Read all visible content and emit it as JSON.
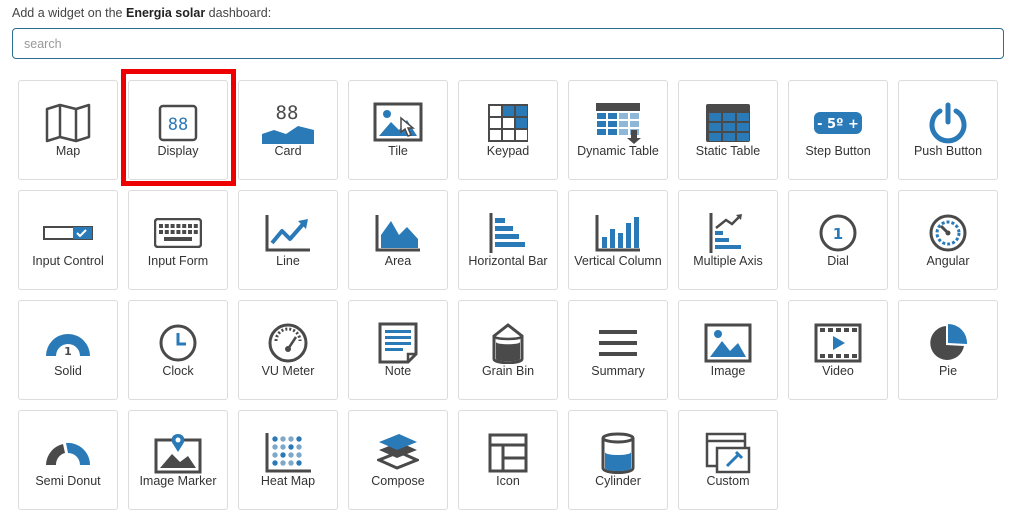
{
  "header": {
    "prefix": "Add a widget on the ",
    "dashboard_name": "Energia solar",
    "suffix": " dashboard:"
  },
  "search": {
    "placeholder": "search",
    "value": ""
  },
  "colors": {
    "accent": "#2a7ab8",
    "dark": "#4a4a4a",
    "highlight": "#ee0000"
  },
  "highlighted_widget": "Display",
  "widgets": [
    {
      "label": "Map",
      "icon": "map-icon"
    },
    {
      "label": "Display",
      "icon": "display-icon"
    },
    {
      "label": "Card",
      "icon": "card-icon"
    },
    {
      "label": "Tile",
      "icon": "tile-icon"
    },
    {
      "label": "Keypad",
      "icon": "keypad-icon"
    },
    {
      "label": "Dynamic Table",
      "icon": "dynamic-table-icon"
    },
    {
      "label": "Static Table",
      "icon": "static-table-icon"
    },
    {
      "label": "Step Button",
      "icon": "step-button-icon"
    },
    {
      "label": "Push Button",
      "icon": "power-icon"
    },
    {
      "label": "Input Control",
      "icon": "input-control-icon"
    },
    {
      "label": "Input Form",
      "icon": "keyboard-icon"
    },
    {
      "label": "Line",
      "icon": "line-chart-icon"
    },
    {
      "label": "Area",
      "icon": "area-chart-icon"
    },
    {
      "label": "Horizontal Bar",
      "icon": "horizontal-bar-icon"
    },
    {
      "label": "Vertical Column",
      "icon": "vertical-column-icon"
    },
    {
      "label": "Multiple Axis",
      "icon": "multiple-axis-icon"
    },
    {
      "label": "Dial",
      "icon": "dial-icon"
    },
    {
      "label": "Angular",
      "icon": "angular-gauge-icon"
    },
    {
      "label": "Solid",
      "icon": "solid-gauge-icon"
    },
    {
      "label": "Clock",
      "icon": "clock-icon"
    },
    {
      "label": "VU Meter",
      "icon": "vu-meter-icon"
    },
    {
      "label": "Note",
      "icon": "note-icon"
    },
    {
      "label": "Grain Bin",
      "icon": "grain-bin-icon"
    },
    {
      "label": "Summary",
      "icon": "summary-icon"
    },
    {
      "label": "Image",
      "icon": "image-icon"
    },
    {
      "label": "Video",
      "icon": "video-icon"
    },
    {
      "label": "Pie",
      "icon": "pie-icon"
    },
    {
      "label": "Semi Donut",
      "icon": "semi-donut-icon"
    },
    {
      "label": "Image Marker",
      "icon": "image-marker-icon"
    },
    {
      "label": "Heat Map",
      "icon": "heat-map-icon"
    },
    {
      "label": "Compose",
      "icon": "compose-icon"
    },
    {
      "label": "Icon",
      "icon": "icon-layout-icon"
    },
    {
      "label": "Cylinder",
      "icon": "cylinder-icon"
    },
    {
      "label": "Custom",
      "icon": "custom-icon"
    }
  ]
}
